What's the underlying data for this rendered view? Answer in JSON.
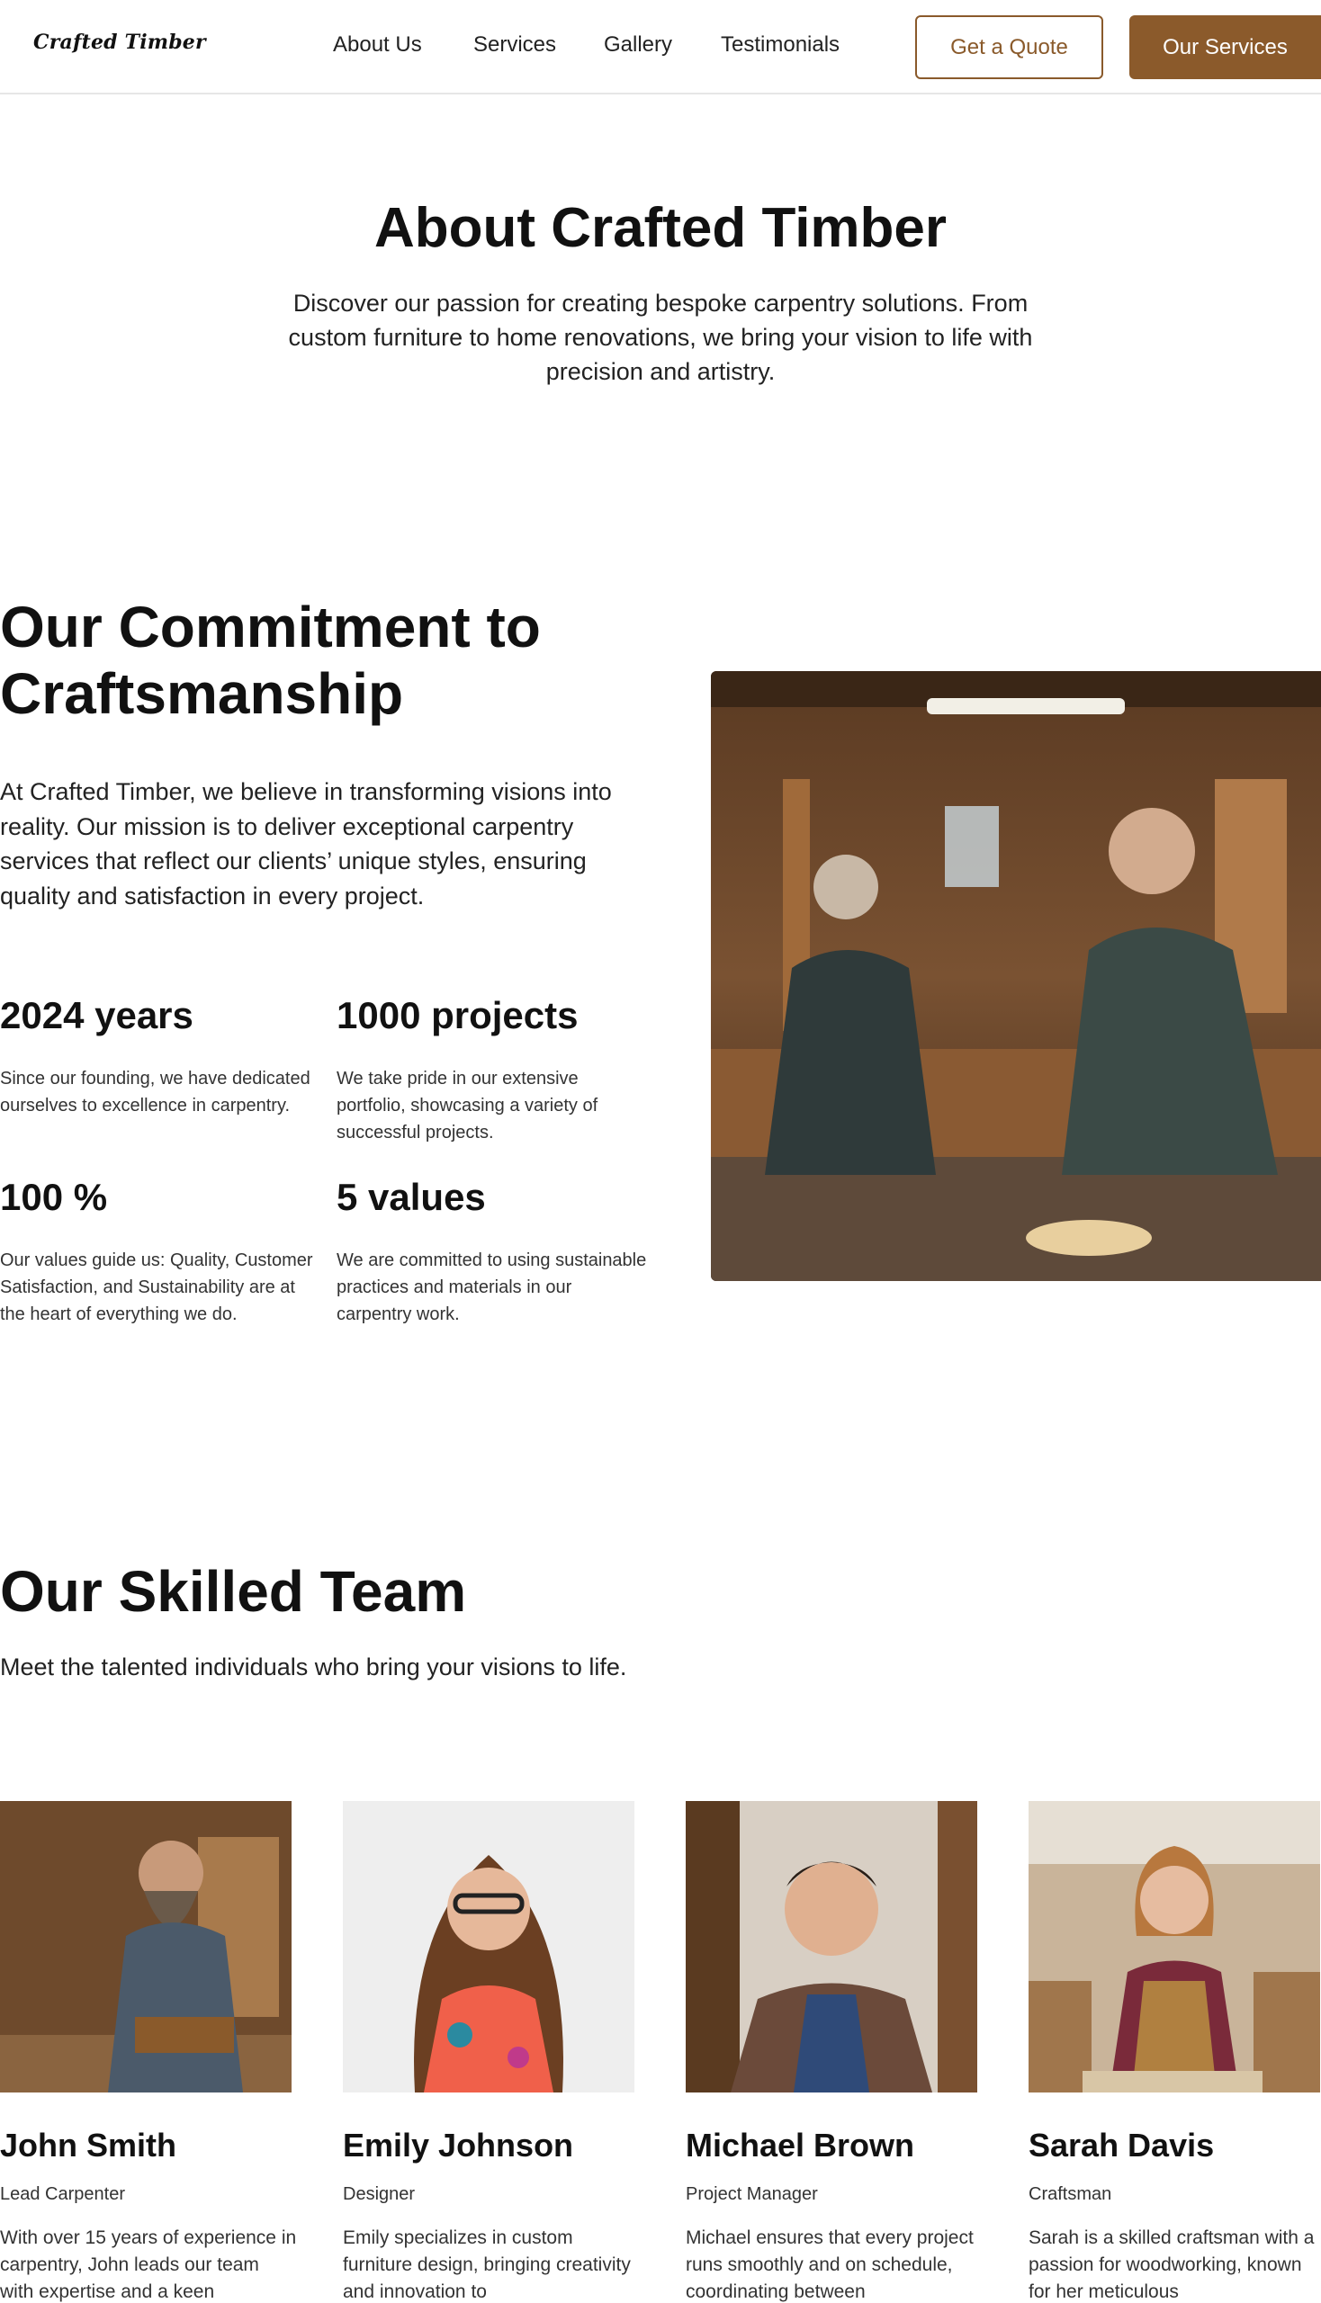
{
  "header": {
    "logo": "Crafted Timber",
    "nav": [
      "About Us",
      "Services",
      "Gallery",
      "Testimonials"
    ],
    "quote_button": "Get a Quote",
    "services_button": "Our Services"
  },
  "hero": {
    "title": "About Crafted Timber",
    "subtitle": "Discover our passion for creating bespoke carpentry solutions. From custom furniture to home renovations, we bring your vision to life with precision and artistry."
  },
  "commitment": {
    "title": "Our Commitment to Craftsmanship",
    "body": "At Crafted Timber, we believe in transforming visions into reality. Our mission is to deliver exceptional carpentry services that reflect our clients’ unique styles, ensuring quality and satisfaction in every project.",
    "stats": [
      {
        "number": "2024 years",
        "description": "Since our founding, we have dedicated ourselves to excellence in carpentry."
      },
      {
        "number": "1000 projects",
        "description": "We take pride in our extensive portfolio, showcasing a variety of successful projects."
      },
      {
        "number": "100 %",
        "description": "Our values guide us: Quality, Customer Satisfaction, and Sustainability are at the heart of everything we do."
      },
      {
        "number": "5 values",
        "description": "We are committed to using sustainable practices and materials in our carpentry work."
      }
    ]
  },
  "team": {
    "title": "Our Skilled Team",
    "subtitle": "Meet the talented individuals who bring your visions to life.",
    "members": [
      {
        "name": "John Smith",
        "role": "Lead Carpenter",
        "bio": "With over 15 years of experience in carpentry, John leads our team with expertise and a keen"
      },
      {
        "name": "Emily Johnson",
        "role": "Designer",
        "bio": "Emily specializes in custom furniture design, bringing creativity and innovation to"
      },
      {
        "name": "Michael Brown",
        "role": "Project Manager",
        "bio": "Michael ensures that every project runs smoothly and on schedule, coordinating between"
      },
      {
        "name": "Sarah Davis",
        "role": "Craftsman",
        "bio": "Sarah is a skilled craftsman with a passion for woodworking, known for her meticulous"
      }
    ]
  },
  "colors": {
    "accent": "#8b5a2b",
    "text": "#111111",
    "border": "#e6e6e6"
  }
}
